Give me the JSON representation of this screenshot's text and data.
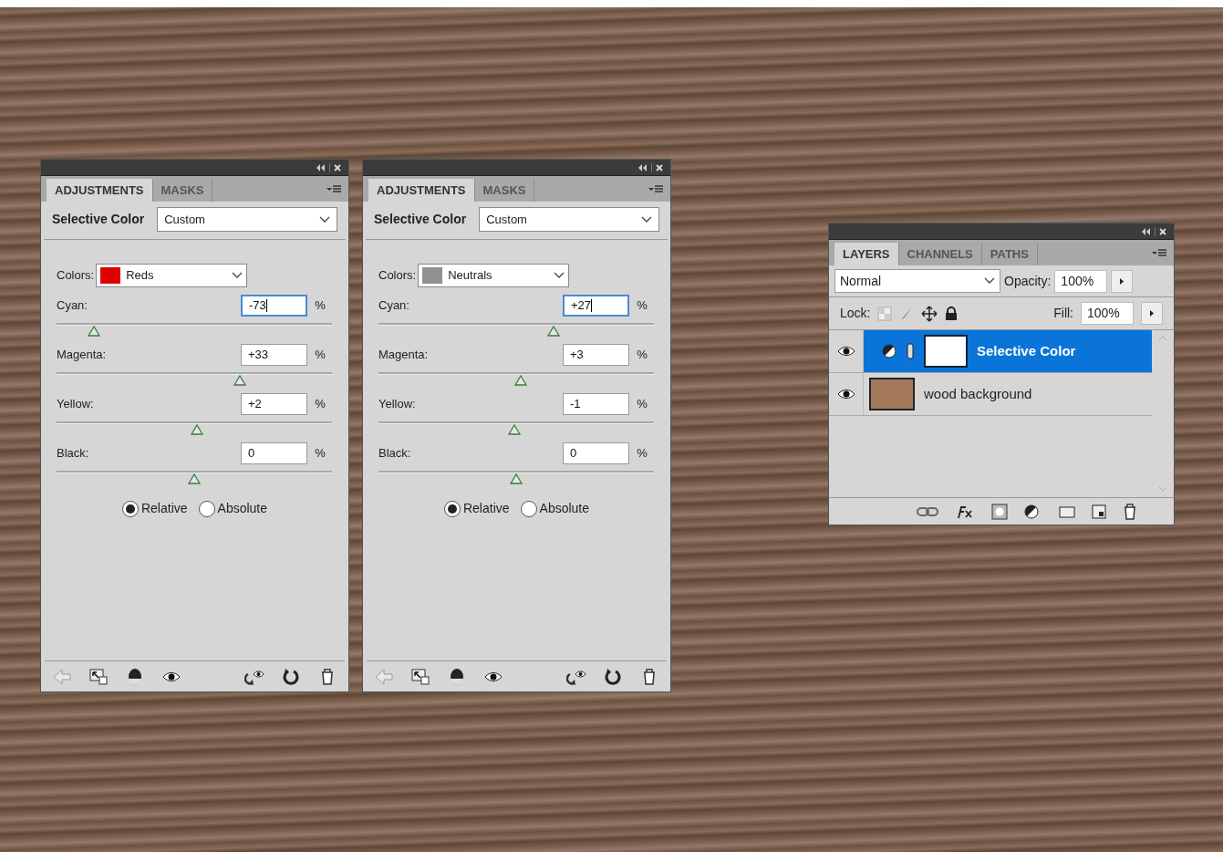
{
  "adjustment_panels": [
    {
      "tabs": [
        {
          "label": "ADJUSTMENTS",
          "selected": true
        },
        {
          "label": "MASKS",
          "selected": false
        }
      ],
      "title": "Selective Color",
      "preset": "Custom",
      "colors": {
        "label": "Colors:",
        "value": "Reds",
        "color": "#e00000"
      },
      "sliders": [
        {
          "label": "Cyan:",
          "value": "-73",
          "unit": "%",
          "level": 0.135,
          "focused": true
        },
        {
          "label": "Magenta:",
          "value": "+33",
          "unit": "%",
          "level": 0.665,
          "focused": false
        },
        {
          "label": "Yellow:",
          "value": "+2",
          "unit": "%",
          "level": 0.51,
          "focused": false
        },
        {
          "label": "Black:",
          "value": "0",
          "unit": "%",
          "level": 0.5,
          "focused": false
        }
      ],
      "modes": [
        {
          "label": "Relative",
          "selected": true
        },
        {
          "label": "Absolute",
          "selected": false
        }
      ]
    },
    {
      "tabs": [
        {
          "label": "ADJUSTMENTS",
          "selected": true
        },
        {
          "label": "MASKS",
          "selected": false
        }
      ],
      "title": "Selective Color",
      "preset": "Custom",
      "colors": {
        "label": "Colors:",
        "value": "Neutrals",
        "color": "#909090"
      },
      "sliders": [
        {
          "label": "Cyan:",
          "value": "+27",
          "unit": "%",
          "level": 0.635,
          "focused": true
        },
        {
          "label": "Magenta:",
          "value": "+3",
          "unit": "%",
          "level": 0.515,
          "focused": false
        },
        {
          "label": "Yellow:",
          "value": "-1",
          "unit": "%",
          "level": 0.495,
          "focused": false
        },
        {
          "label": "Black:",
          "value": "0",
          "unit": "%",
          "level": 0.5,
          "focused": false
        }
      ],
      "modes": [
        {
          "label": "Relative",
          "selected": true
        },
        {
          "label": "Absolute",
          "selected": false
        }
      ]
    }
  ],
  "layers_panel": {
    "tabs": [
      {
        "label": "LAYERS",
        "selected": true
      },
      {
        "label": "CHANNELS",
        "selected": false
      },
      {
        "label": "PATHS",
        "selected": false
      }
    ],
    "blend_mode": "Normal",
    "opacity_label": "Opacity:",
    "opacity": "100%",
    "lock_label": "Lock:",
    "fill_label": "Fill:",
    "fill": "100%",
    "layers": [
      {
        "name": "Selective Color",
        "kind": "adjustment",
        "selected": true,
        "visible": true
      },
      {
        "name": "wood background",
        "kind": "image",
        "selected": false,
        "visible": true
      }
    ]
  }
}
